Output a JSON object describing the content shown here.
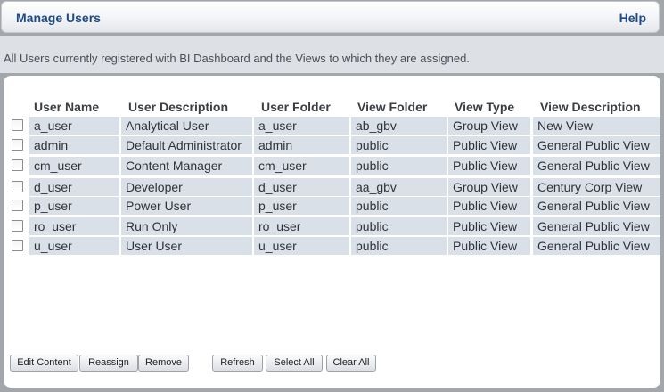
{
  "header": {
    "title": "Manage Users",
    "help_label": "Help"
  },
  "info_text": "All Users currently registered with BI Dashboard and the Views to which they are assigned.",
  "table": {
    "columns": [
      "User Name",
      "User Description",
      "User Folder",
      "View Folder",
      "View Type",
      "View Description"
    ],
    "rows": [
      [
        "a_user",
        "Analytical User",
        "a_user",
        "ab_gbv",
        "Group View",
        "New View"
      ],
      [
        "admin",
        "Default Administrator",
        "admin",
        "public",
        "Public View",
        "General Public View"
      ],
      [
        "cm_user",
        "Content Manager",
        "cm_user",
        "public",
        "Public View",
        "General Public View"
      ],
      [
        "d_user",
        "Developer",
        "d_user",
        "aa_gbv",
        "Group View",
        "Century Corp View"
      ],
      [
        "p_user",
        "Power User",
        "p_user",
        "public",
        "Public View",
        "General Public View"
      ],
      [
        "ro_user",
        "Run Only",
        "ro_user",
        "public",
        "Public View",
        "General Public View"
      ],
      [
        "u_user",
        "User User",
        "u_user",
        "public",
        "Public View",
        "General Public View"
      ]
    ]
  },
  "buttons": {
    "edit_content": "Edit Content",
    "reassign": "Reassign",
    "remove": "Remove",
    "refresh": "Refresh",
    "select_all": "Select All",
    "clear_all": "Clear All"
  },
  "colors": {
    "title": "#1d4a8a",
    "cell_bg": "#d9e0e7",
    "page_bg": "#a3a6aa"
  }
}
